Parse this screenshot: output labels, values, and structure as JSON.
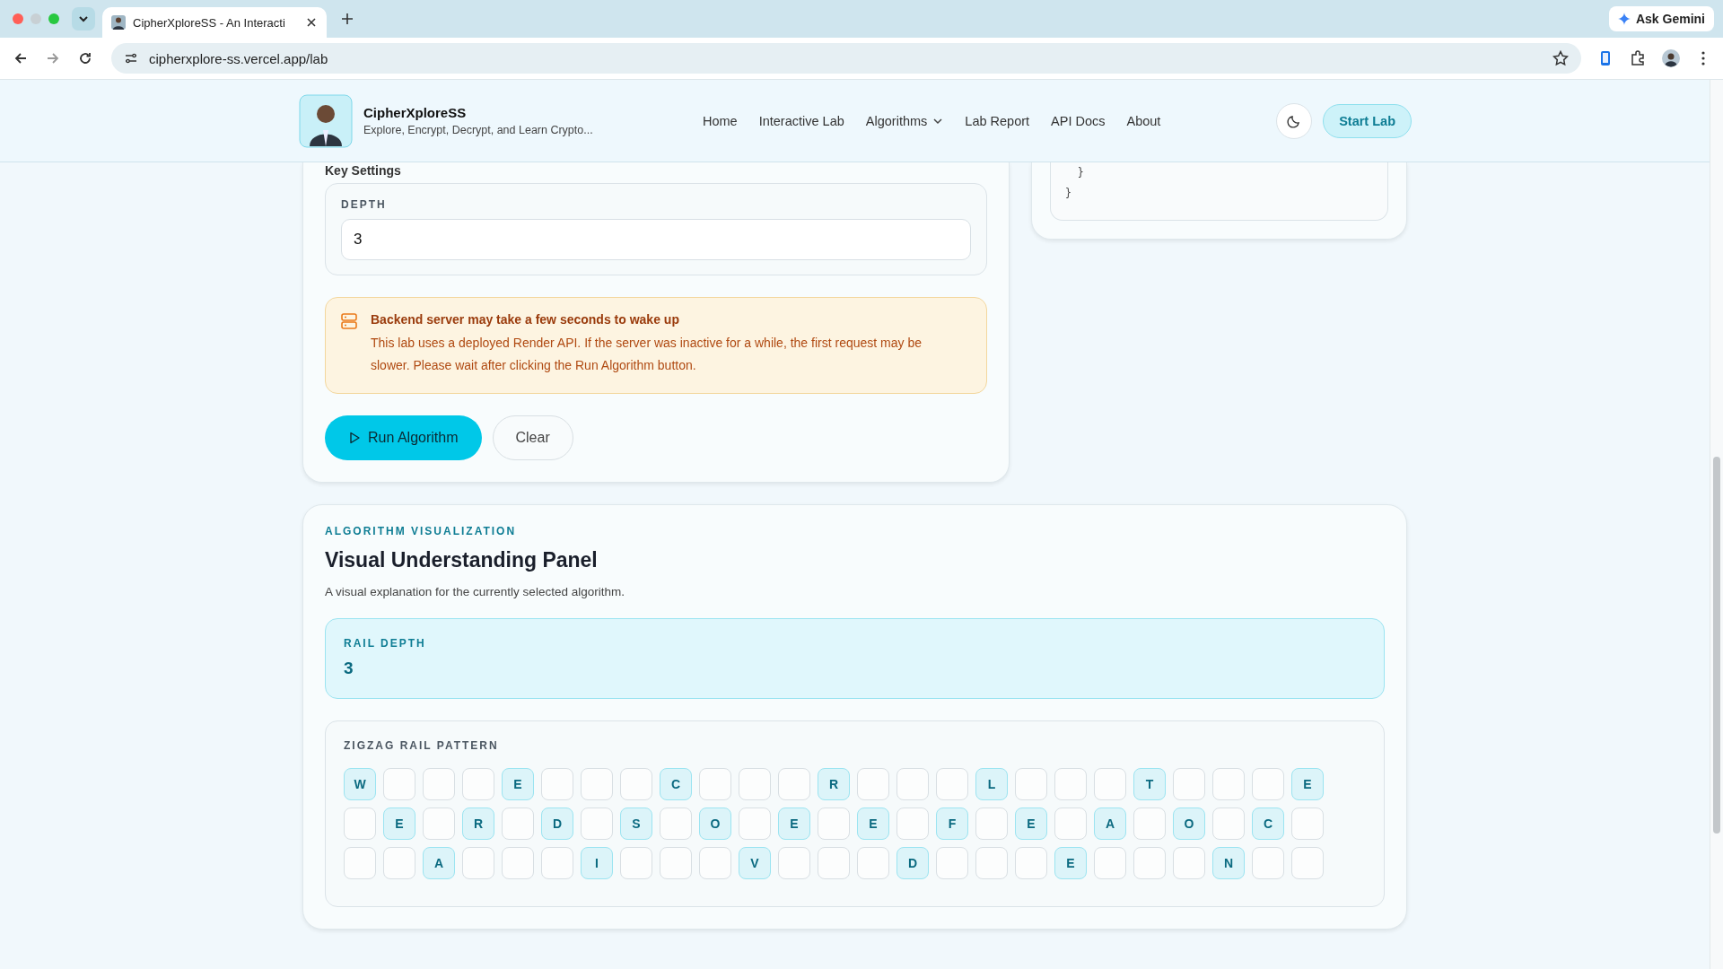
{
  "browser": {
    "tab_title": "CipherXploreSS - An Interacti",
    "url": "cipherxplore-ss.vercel.app/lab",
    "ask_button": "Ask Gemini"
  },
  "header": {
    "brand": "CipherXploreSS",
    "tagline": "Explore, Encrypt, Decrypt, and Learn Crypto...",
    "nav": [
      {
        "label": "Home",
        "dropdown": false
      },
      {
        "label": "Interactive Lab",
        "dropdown": false
      },
      {
        "label": "Algorithms",
        "dropdown": true
      },
      {
        "label": "Lab Report",
        "dropdown": false
      },
      {
        "label": "API Docs",
        "dropdown": false
      },
      {
        "label": "About",
        "dropdown": false
      }
    ],
    "cta": "Start Lab"
  },
  "key_settings": {
    "heading": "Key Settings",
    "field_label": "DEPTH",
    "field_value": "3"
  },
  "notice": {
    "title": "Backend server may take a few seconds to wake up",
    "text": "This lab uses a deployed Render API. If the server was inactive for a while, the first request may be slower. Please wait after clicking the Run Algorithm button."
  },
  "actions": {
    "run": "Run Algorithm",
    "clear": "Clear"
  },
  "code_lines": [
    "  }",
    "}"
  ],
  "visualization": {
    "eyebrow": "ALGORITHM VISUALIZATION",
    "title": "Visual Understanding Panel",
    "description": "A visual explanation for the currently selected algorithm.",
    "depth_label": "RAIL DEPTH",
    "depth_value": "3",
    "pattern_label": "ZIGZAG RAIL PATTERN",
    "rails": [
      [
        {
          "kind": "letter",
          "letter": "W"
        },
        {
          "kind": "empty"
        },
        {
          "kind": "empty"
        },
        {
          "kind": "empty"
        },
        {
          "kind": "letter",
          "letter": "E"
        },
        {
          "kind": "empty"
        },
        {
          "kind": "empty"
        },
        {
          "kind": "empty"
        },
        {
          "kind": "letter",
          "letter": "C"
        },
        {
          "kind": "empty"
        },
        {
          "kind": "empty"
        },
        {
          "kind": "empty"
        },
        {
          "kind": "letter",
          "letter": "R"
        },
        {
          "kind": "empty"
        },
        {
          "kind": "empty"
        },
        {
          "kind": "empty"
        },
        {
          "kind": "letter",
          "letter": "L"
        },
        {
          "kind": "empty"
        },
        {
          "kind": "empty"
        },
        {
          "kind": "empty"
        },
        {
          "kind": "letter",
          "letter": "T"
        },
        {
          "kind": "empty"
        },
        {
          "kind": "empty"
        },
        {
          "kind": "empty"
        },
        {
          "kind": "letter",
          "letter": "E"
        }
      ],
      [
        {
          "kind": "empty"
        },
        {
          "kind": "letter",
          "letter": "E"
        },
        {
          "kind": "empty"
        },
        {
          "kind": "letter",
          "letter": "R"
        },
        {
          "kind": "empty"
        },
        {
          "kind": "letter",
          "letter": "D"
        },
        {
          "kind": "empty"
        },
        {
          "kind": "letter",
          "letter": "S"
        },
        {
          "kind": "empty"
        },
        {
          "kind": "letter",
          "letter": "O"
        },
        {
          "kind": "empty"
        },
        {
          "kind": "letter",
          "letter": "E"
        },
        {
          "kind": "empty"
        },
        {
          "kind": "letter",
          "letter": "E"
        },
        {
          "kind": "empty"
        },
        {
          "kind": "letter",
          "letter": "F"
        },
        {
          "kind": "empty"
        },
        {
          "kind": "letter",
          "letter": "E"
        },
        {
          "kind": "empty"
        },
        {
          "kind": "letter",
          "letter": "A"
        },
        {
          "kind": "empty"
        },
        {
          "kind": "letter",
          "letter": "O"
        },
        {
          "kind": "empty"
        },
        {
          "kind": "letter",
          "letter": "C"
        },
        {
          "kind": "empty"
        }
      ],
      [
        {
          "kind": "empty"
        },
        {
          "kind": "empty"
        },
        {
          "kind": "letter",
          "letter": "A"
        },
        {
          "kind": "empty"
        },
        {
          "kind": "empty"
        },
        {
          "kind": "empty"
        },
        {
          "kind": "letter",
          "letter": "I"
        },
        {
          "kind": "empty"
        },
        {
          "kind": "empty"
        },
        {
          "kind": "empty"
        },
        {
          "kind": "letter",
          "letter": "V"
        },
        {
          "kind": "empty"
        },
        {
          "kind": "empty"
        },
        {
          "kind": "empty"
        },
        {
          "kind": "letter",
          "letter": "D"
        },
        {
          "kind": "empty"
        },
        {
          "kind": "empty"
        },
        {
          "kind": "empty"
        },
        {
          "kind": "letter",
          "letter": "E"
        },
        {
          "kind": "empty"
        },
        {
          "kind": "empty"
        },
        {
          "kind": "empty"
        },
        {
          "kind": "letter",
          "letter": "N"
        },
        {
          "kind": "empty"
        },
        {
          "kind": "empty"
        }
      ]
    ]
  }
}
